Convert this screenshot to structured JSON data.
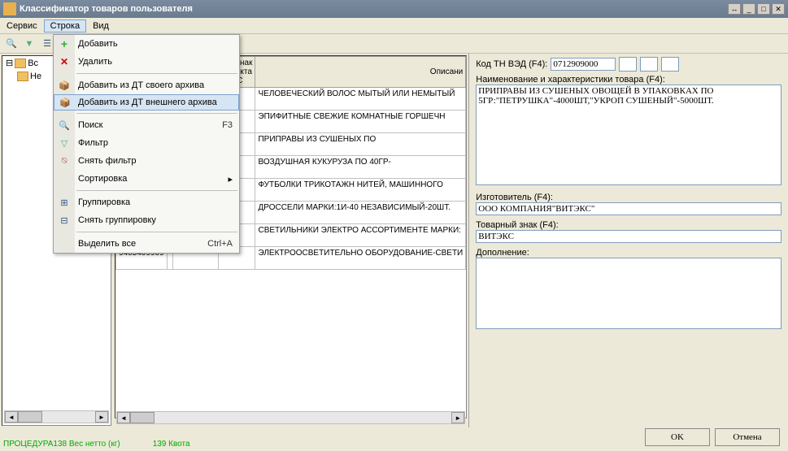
{
  "title": "Классификатор товаров пользователя",
  "menubar": [
    "Сервис",
    "Строка",
    "Вид"
  ],
  "tree": {
    "items": [
      "Вс",
      "Не"
    ]
  },
  "context_menu": {
    "items": [
      {
        "label": "Добавить",
        "icon": "plus"
      },
      {
        "label": "Удалить",
        "icon": "x"
      },
      {
        "sep": true
      },
      {
        "label": "Добавить из ДТ своего архива",
        "icon": "box"
      },
      {
        "label": "Добавить из ДТ внешнего архива",
        "icon": "box",
        "hover": true
      },
      {
        "sep": true
      },
      {
        "label": "Поиск",
        "icon": "search",
        "shortcut": "F3"
      },
      {
        "label": "Фильтр",
        "icon": "funnel"
      },
      {
        "label": "Снять фильтр",
        "icon": "nofunnel"
      },
      {
        "label": "Сортировка",
        "sub": true
      },
      {
        "sep": true
      },
      {
        "label": "Группировка",
        "icon": "group"
      },
      {
        "label": "Снять группировку",
        "icon": "ungroup"
      },
      {
        "sep": true
      },
      {
        "label": "Выделить все",
        "shortcut": "Ctrl+A"
      }
    ]
  },
  "grid": {
    "headers": [
      "",
      "",
      "Признак тарифного регулир.",
      "Признак объекта ИС",
      "Описани"
    ],
    "rows": [
      {
        "c0": "",
        "c1": "",
        "desc": "ЧЕЛОВЕЧЕСКИЙ ВОЛОС МЫТЫЙ ИЛИ НЕМЫТЫЙ"
      },
      {
        "c0": "",
        "c1": "",
        "desc": "ЭПИФИТНЫЕ СВЕЖИЕ КОМНАТНЫЕ ГОРШЕЧН"
      },
      {
        "c0": "",
        "c1": "",
        "desc": "ПРИПРАВЫ ИЗ СУШЕНЫХ ПО"
      },
      {
        "c0": "",
        "c1": "",
        "desc": "ВОЗДУШНАЯ КУКУРУЗА ПО 40ГР-"
      },
      {
        "c0": "",
        "c1": "",
        "desc": "ФУТБОЛКИ ТРИКОТАЖН НИТЕЙ, МАШИННОГО"
      },
      {
        "c0": "",
        "c1": "",
        "desc": "ДРОССЕЛИ МАРКИ:1И-40 НЕЗАВИСИМЫЙ-20ШТ."
      },
      {
        "c0": "9405105009",
        "c1": "",
        "desc": "СВЕТИЛЬНИКИ ЭЛЕКТРО АССОРТИМЕНТЕ МАРКИ:"
      },
      {
        "c0": "9405409909",
        "c1": "",
        "desc": "ЭЛЕКТРООСВЕТИТЕЛЬНО ОБОРУДОВАНИЕ-СВЕТИ"
      }
    ]
  },
  "right_panel": {
    "code_label": "Код ТН ВЭД (F4):",
    "code_value": "0712909000",
    "name_label": "Наименование и характеристики товара (F4):",
    "name_value": "ПРИПРАВЫ ИЗ СУШЕНЫХ ОВОЩЕЙ В УПАКОВКАХ ПО 5ГР:\"ПЕТРУШКА\"-4000ШТ,\"УКРОП СУШЕНЫЙ\"-5000ШТ.",
    "maker_label": "Изготовитель (F4):",
    "maker_value": "ООО КОМПАНИЯ\"ВИТЭКС\"",
    "tm_label": "Товарный знак (F4):",
    "tm_value": "ВИТЭКС",
    "add_label": "Дополнение:",
    "add_value": ""
  },
  "buttons": {
    "ok": "OK",
    "cancel": "Отмена"
  },
  "status": {
    "left": "ПРОЦЕДУРА138 Вес нетто (кг)",
    "right": "139 Квота"
  }
}
